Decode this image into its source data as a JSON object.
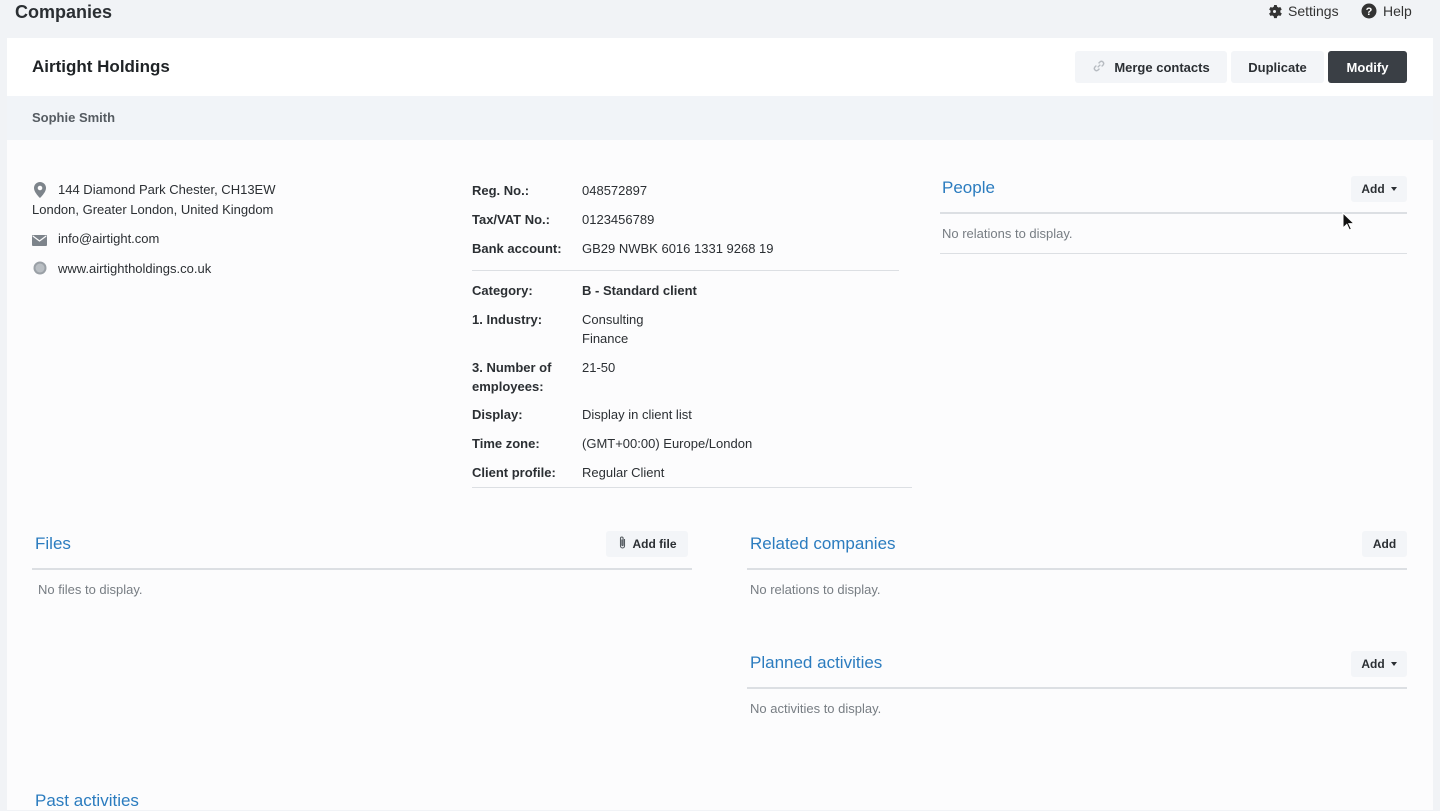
{
  "topbar": {
    "title": "Companies",
    "settings_label": "Settings",
    "help_label": "Help"
  },
  "header": {
    "company_name": "Airtight Holdings",
    "merge_label": "Merge contacts",
    "duplicate_label": "Duplicate",
    "modify_label": "Modify"
  },
  "owner": {
    "name": "Sophie Smith"
  },
  "contact": {
    "address_line1": "144 Diamond Park Chester, CH13EW",
    "address_line2": "London, Greater London, United Kingdom",
    "email": "info@airtight.com",
    "website": "www.airtightholdings.co.uk"
  },
  "details": {
    "reg_label": "Reg. No.:",
    "reg_value": "048572897",
    "tax_label": "Tax/VAT No.:",
    "tax_value": "0123456789",
    "bank_label": "Bank account:",
    "bank_value": "GB29 NWBK 6016 1331 9268 19",
    "category_label": "Category:",
    "category_value": "B - Standard client",
    "industry_label": "1. Industry:",
    "industry_values": [
      "Consulting",
      "Finance"
    ],
    "employees_label_line1": "3. Number of",
    "employees_label_line2": "employees:",
    "employees_value": "21-50",
    "display_label": "Display:",
    "display_value": "Display in client list",
    "timezone_label": "Time zone:",
    "timezone_value": "(GMT+00:00) Europe/London",
    "profile_label": "Client profile:",
    "profile_value": "Regular Client"
  },
  "people": {
    "title": "People",
    "add_label": "Add",
    "empty": "No relations to display."
  },
  "files": {
    "title": "Files",
    "add_label": "Add file",
    "empty": "No files to display."
  },
  "related": {
    "title": "Related companies",
    "add_label": "Add",
    "empty": "No relations to display."
  },
  "planned": {
    "title": "Planned activities",
    "add_label": "Add",
    "empty": "No activities to display."
  },
  "past": {
    "title": "Past activities"
  },
  "colors": {
    "accent": "#2b7cbf",
    "dark_button": "#3a3f45",
    "page_bg": "#f1f3f6"
  }
}
